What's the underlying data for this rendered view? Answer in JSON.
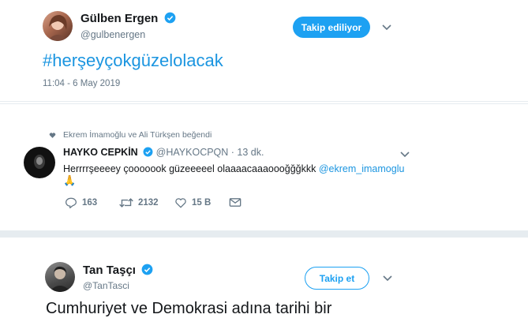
{
  "tweet1": {
    "author_name": "Gülben Ergen",
    "author_handle": "@gulbenergen",
    "follow_label": "Takip ediliyor",
    "text": "#herşeyçokgüzelolacak",
    "timestamp": "11:04 - 6 May 2019"
  },
  "liked_by": "Ekrem İmamoğlu ve Ali Türkşen beğendi",
  "reply": {
    "author_name": "HAYKO CEPKİN",
    "author_handle": "@HAYKOCPQN",
    "time": "· 13 dk.",
    "text": "Herrrrşeeeey çooooook güzeeeeel olaaaacaaaoooğğğkkk",
    "mention": "@ekrem_imamoglu",
    "emoji": "🙏",
    "counts": {
      "replies": "163",
      "retweets": "2132",
      "likes": "15 B"
    }
  },
  "tweet2": {
    "author_name": "Tan Taşçı",
    "author_handle": "@TanTasci",
    "follow_label": "Takip et",
    "text": "Cumhuriyet ve Demokrasi adına tarihi bir"
  },
  "colors": {
    "accent": "#1da1f2",
    "link": "#1b95e0",
    "muted": "#657786"
  }
}
